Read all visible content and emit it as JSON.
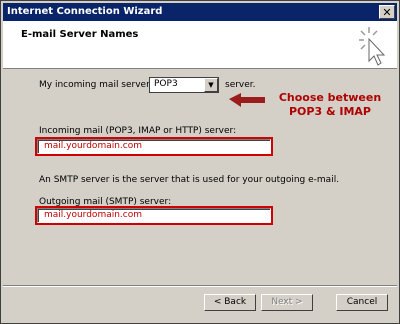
{
  "window": {
    "title": "Internet Connection Wizard",
    "close_glyph": "✕"
  },
  "header": {
    "title": "E-mail Server Names"
  },
  "incoming_server": {
    "label_prefix": "My incoming mail server is a",
    "selected": "POP3",
    "label_suffix": "server."
  },
  "callout": {
    "line1": "Choose between",
    "line2": "POP3 & IMAP",
    "color": "#b00000"
  },
  "incoming_mail": {
    "label": "Incoming mail (POP3, IMAP or HTTP) server:",
    "value": "mail.yourdomain.com"
  },
  "smtp": {
    "description": "An SMTP server is the server that is used for your outgoing e-mail.",
    "label": "Outgoing mail (SMTP) server:",
    "value": "mail.yourdomain.com"
  },
  "buttons": {
    "back": "< Back",
    "next": "Next >",
    "cancel": "Cancel"
  }
}
